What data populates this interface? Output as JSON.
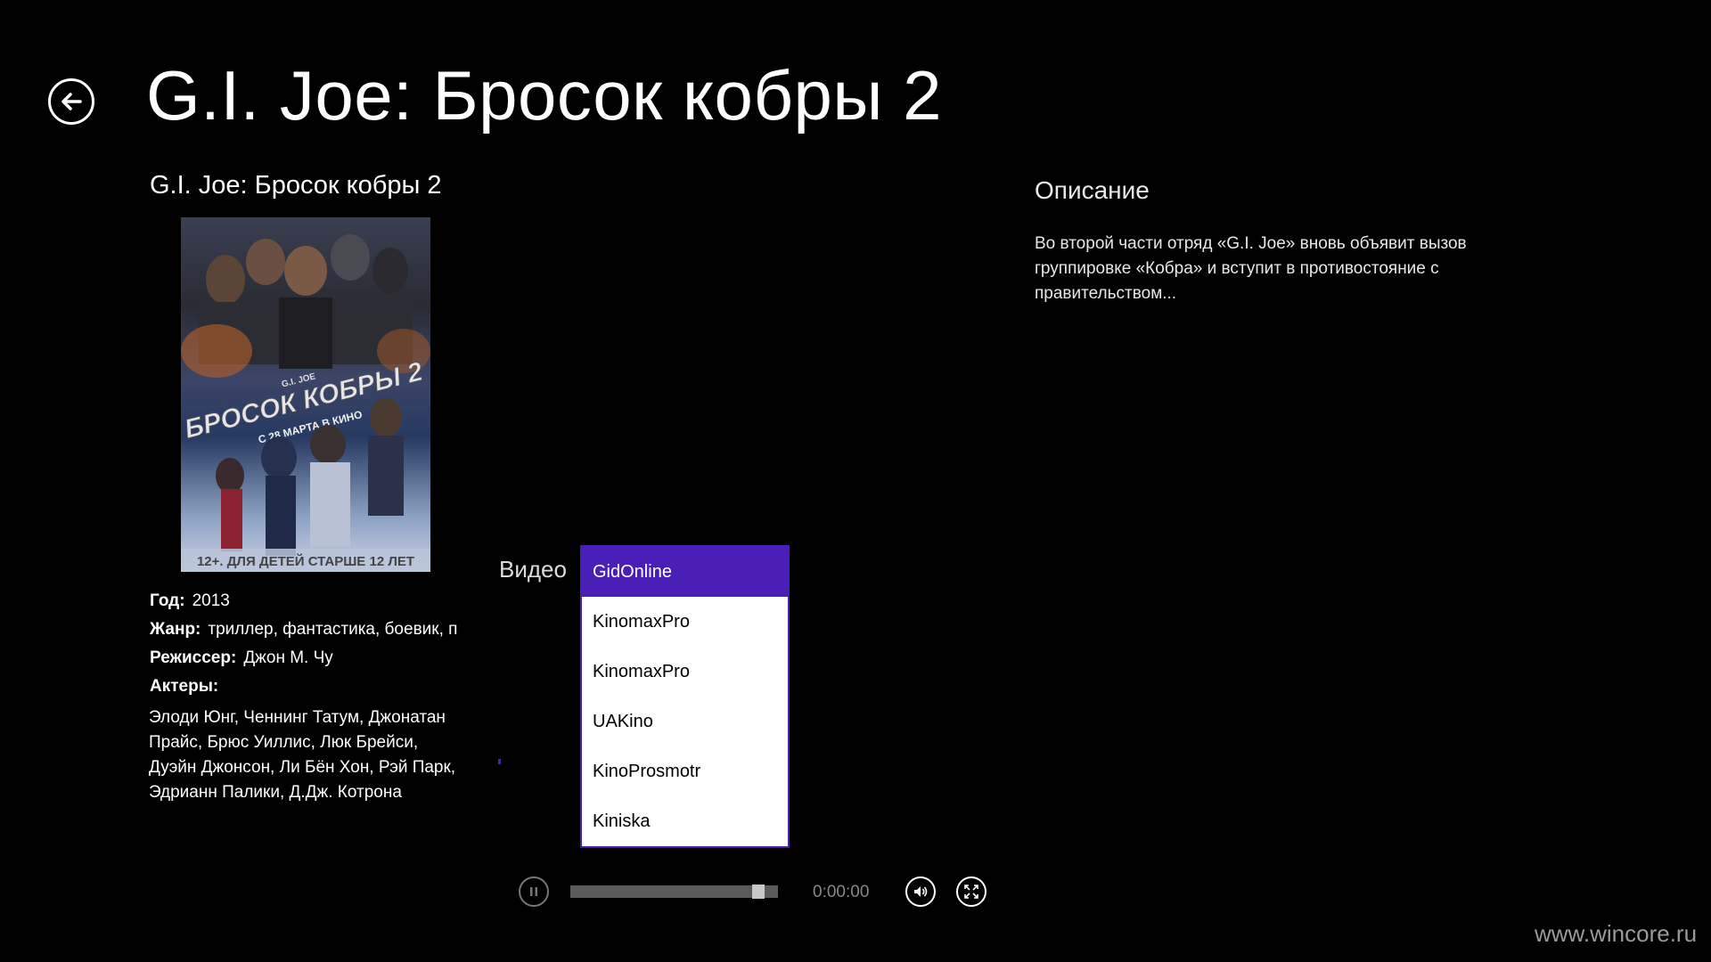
{
  "header": {
    "title": "G.I. Joe: Бросок кобры 2"
  },
  "details": {
    "subtitle": "G.I. Joe: Бросок кобры 2",
    "year_label": "Год:",
    "year": "2013",
    "genre_label": "Жанр:",
    "genre": "триллер, фантастика, боевик, п",
    "director_label": "Режиссер:",
    "director": "Джон М. Чу",
    "actors_label": "Актеры:",
    "actors": "Элоди Юнг, Ченнинг Татум, Джонатан Прайс, Брюс Уиллис, Люк Брейси, Дуэйн Джонсон, Ли Бён Хон, Рэй Парк, Эдрианн Палики, Д.Дж. Котрона"
  },
  "poster": {
    "title_text": "БРОСОК КОБРЫ 2",
    "small_text": "G.I. JOE",
    "release_text": "С 28 МАРТА В КИНО",
    "age_text": "12+. ДЛЯ ДЕТЕЙ СТАРШЕ 12 ЛЕТ"
  },
  "description": {
    "heading": "Описание",
    "text": "Во второй части отряд «G.I. Joe» вновь объявит вызов группировке «Кобра» и вступит в противостояние с правительством..."
  },
  "video": {
    "label": "Видео",
    "sources": [
      "GidOnline",
      "KinomaxPro",
      "KinomaxPro",
      "UAKino",
      "KinoProsmotr",
      "Kiniska"
    ],
    "selected_index": 0
  },
  "player": {
    "time": "0:00:00",
    "progress": 0.93
  },
  "colors": {
    "accent": "#4a1fb8",
    "background": "#000000"
  },
  "icons": {
    "back": "back-arrow-icon",
    "pause": "pause-icon",
    "volume": "volume-icon",
    "fullscreen": "fullscreen-icon"
  },
  "watermark": "www.wincore.ru"
}
